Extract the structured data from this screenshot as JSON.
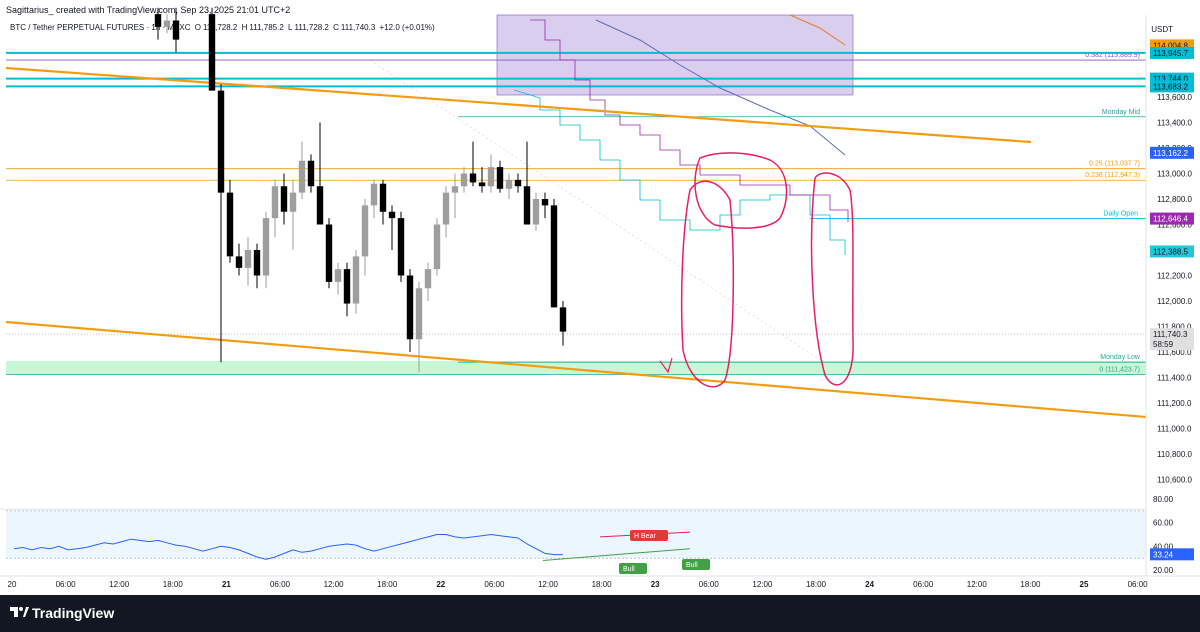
{
  "header": {
    "author_line": "Sagittarius_ created with TradingView.com, Sep 23, 2025 21:01 UTC+2",
    "symbol": "BTC / Tether PERPETUAL FUTURES · 1h · MEXC",
    "ohlc": [
      {
        "k": "O",
        "v": "111,728.2"
      },
      {
        "k": "H",
        "v": "111,785.2"
      },
      {
        "k": "L",
        "v": "111,728.2"
      },
      {
        "k": "C",
        "v": "111,740.3"
      }
    ],
    "change": "+12.0 (+0.01%)",
    "currency": "USDT"
  },
  "footer": {
    "brand": "TradingView"
  },
  "colors": {
    "bull": "#9e9e9e",
    "bear": "#000000",
    "trend": "#f39c12",
    "cyan": "#00bcd4",
    "highlight": "#e91e63",
    "rsi": "#2962ff",
    "zone_purple": "#b39ddb",
    "zone_green": "#b9f6ca"
  },
  "chart_data": {
    "type": "candlestick",
    "price_axis": {
      "min": 110400,
      "max": 114200,
      "ticks": [
        "113,600.0",
        "113,400.0",
        "113,200.0",
        "113,000.0",
        "112,800.0",
        "112,600.0",
        "112,400.0",
        "112,200.0",
        "112,000.0",
        "111,800.0",
        "111,600.0",
        "111,400.0",
        "111,200.0",
        "111,000.0",
        "110,800.0",
        "110,600.0"
      ]
    },
    "time_axis": [
      "20",
      "06:00",
      "12:00",
      "18:00",
      "21",
      "06:00",
      "12:00",
      "18:00",
      "22",
      "06:00",
      "12:00",
      "18:00",
      "23",
      "06:00",
      "12:00",
      "18:00",
      "24",
      "06:00",
      "12:00",
      "18:00",
      "25",
      "06:00"
    ],
    "candles": [
      {
        "t": 16,
        "o": 114250,
        "h": 114300,
        "l": 114050,
        "c": 114150
      },
      {
        "t": 17,
        "o": 114150,
        "h": 114250,
        "l": 114100,
        "c": 114200
      },
      {
        "t": 18,
        "o": 114200,
        "h": 114300,
        "l": 113950,
        "c": 114050
      },
      {
        "t": 22,
        "o": 114250,
        "h": 114300,
        "l": 113700,
        "c": 113650
      },
      {
        "t": 23,
        "o": 113650,
        "h": 113700,
        "l": 111520,
        "c": 112850
      },
      {
        "t": 24,
        "o": 112850,
        "h": 112950,
        "l": 112300,
        "c": 112350
      },
      {
        "t": 25,
        "o": 112350,
        "h": 112450,
        "l": 112200,
        "c": 112260
      },
      {
        "t": 26,
        "o": 112260,
        "h": 112500,
        "l": 112120,
        "c": 112400
      },
      {
        "t": 27,
        "o": 112400,
        "h": 112450,
        "l": 112100,
        "c": 112200
      },
      {
        "t": 28,
        "o": 112200,
        "h": 112700,
        "l": 112100,
        "c": 112650
      },
      {
        "t": 29,
        "o": 112650,
        "h": 112950,
        "l": 112500,
        "c": 112900
      },
      {
        "t": 30,
        "o": 112900,
        "h": 113000,
        "l": 112600,
        "c": 112700
      },
      {
        "t": 31,
        "o": 112700,
        "h": 112950,
        "l": 112400,
        "c": 112850
      },
      {
        "t": 32,
        "o": 112850,
        "h": 113250,
        "l": 112800,
        "c": 113100
      },
      {
        "t": 33,
        "o": 113100,
        "h": 113150,
        "l": 112850,
        "c": 112900
      },
      {
        "t": 34,
        "o": 112900,
        "h": 113400,
        "l": 112600,
        "c": 112600
      },
      {
        "t": 35,
        "o": 112600,
        "h": 112650,
        "l": 112100,
        "c": 112150
      },
      {
        "t": 36,
        "o": 112150,
        "h": 112300,
        "l": 112050,
        "c": 112250
      },
      {
        "t": 37,
        "o": 112250,
        "h": 112300,
        "l": 111880,
        "c": 111980
      },
      {
        "t": 38,
        "o": 111980,
        "h": 112400,
        "l": 111900,
        "c": 112350
      },
      {
        "t": 39,
        "o": 112350,
        "h": 112800,
        "l": 112200,
        "c": 112750
      },
      {
        "t": 40,
        "o": 112750,
        "h": 112950,
        "l": 112650,
        "c": 112920
      },
      {
        "t": 41,
        "o": 112920,
        "h": 112950,
        "l": 112600,
        "c": 112700
      },
      {
        "t": 42,
        "o": 112700,
        "h": 112750,
        "l": 112400,
        "c": 112650
      },
      {
        "t": 43,
        "o": 112650,
        "h": 112700,
        "l": 112150,
        "c": 112200
      },
      {
        "t": 44,
        "o": 112200,
        "h": 112250,
        "l": 111600,
        "c": 111700
      },
      {
        "t": 45,
        "o": 111700,
        "h": 112150,
        "l": 111440,
        "c": 112100
      },
      {
        "t": 46,
        "o": 112100,
        "h": 112300,
        "l": 112000,
        "c": 112250
      },
      {
        "t": 47,
        "o": 112250,
        "h": 112650,
        "l": 112200,
        "c": 112600
      },
      {
        "t": 48,
        "o": 112600,
        "h": 112900,
        "l": 112500,
        "c": 112850
      },
      {
        "t": 49,
        "o": 112850,
        "h": 113000,
        "l": 112650,
        "c": 112900
      },
      {
        "t": 50,
        "o": 112900,
        "h": 113050,
        "l": 112850,
        "c": 113000
      },
      {
        "t": 51,
        "o": 113000,
        "h": 113250,
        "l": 112900,
        "c": 112930
      },
      {
        "t": 52,
        "o": 112930,
        "h": 113050,
        "l": 112850,
        "c": 112900
      },
      {
        "t": 53,
        "o": 112900,
        "h": 113150,
        "l": 112850,
        "c": 113050
      },
      {
        "t": 54,
        "o": 113050,
        "h": 113100,
        "l": 112850,
        "c": 112880
      },
      {
        "t": 55,
        "o": 112880,
        "h": 113000,
        "l": 112800,
        "c": 112950
      },
      {
        "t": 56,
        "o": 112950,
        "h": 113000,
        "l": 112850,
        "c": 112900
      },
      {
        "t": 57,
        "o": 112900,
        "h": 113250,
        "l": 112600,
        "c": 112600
      },
      {
        "t": 58,
        "o": 112600,
        "h": 112850,
        "l": 112550,
        "c": 112800
      },
      {
        "t": 59,
        "o": 112800,
        "h": 112850,
        "l": 112650,
        "c": 112750
      },
      {
        "t": 60,
        "o": 112750,
        "h": 112800,
        "l": 111950,
        "c": 111950
      },
      {
        "t": 61,
        "o": 111950,
        "h": 112000,
        "l": 111650,
        "c": 111760
      }
    ],
    "horizontal_levels": [
      {
        "label": "0.382 (113,889.9)",
        "price": 113889.9
      },
      {
        "label": "0.25 (113,037.7)",
        "price": 113037.7
      },
      {
        "label": "0.236 (112,947.3)",
        "price": 112947.3
      },
      {
        "label": "0 (111,423.7)",
        "price": 111423.7
      },
      {
        "label": "Monday Mid",
        "price": 113445
      },
      {
        "label": "Daily Open",
        "price": 112646.4
      },
      {
        "label": "Monday Low",
        "price": 111520
      }
    ],
    "price_badges": [
      "114,004.8",
      "113,945.7",
      "113,744.0",
      "113,683.2",
      "113,162.2",
      "112,646.4",
      "112,388.5",
      "111,740.3",
      "58:59"
    ],
    "bands": {
      "green_zone": [
        111423.7,
        111530
      ]
    },
    "rsi": {
      "ylim": [
        15,
        90
      ],
      "ticks": [
        "80.00",
        "60.00",
        "40.00",
        "20.00"
      ],
      "last": "33.24",
      "labels": [
        {
          "text": "H Bear"
        },
        {
          "text": "Bull"
        },
        {
          "text": "Bull"
        }
      ],
      "values": [
        38,
        39,
        37,
        39,
        38,
        40,
        37,
        38,
        39,
        41,
        43,
        42,
        44,
        46,
        45,
        44,
        45,
        43,
        41,
        40,
        38,
        36,
        38,
        40,
        39,
        37,
        34,
        31,
        29,
        31,
        34,
        37,
        35,
        36,
        38,
        40,
        41,
        42,
        41,
        38,
        36,
        38,
        40,
        42,
        44,
        46,
        48,
        50,
        50,
        48,
        47,
        48,
        49,
        50,
        49,
        48,
        47,
        42,
        38,
        34,
        33,
        33
      ]
    }
  }
}
